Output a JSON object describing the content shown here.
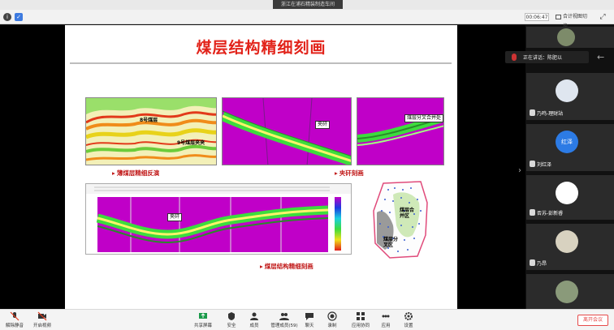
{
  "window": {
    "title": "浙江在浦石精装制造车间"
  },
  "topbar": {
    "time": "00:06:47",
    "view_label": "合计视图切换"
  },
  "slide": {
    "title": "煤层结构精细刻画",
    "captions": {
      "thin_seam": "薄煤层精细反演",
      "interbed": "夹矸刻画",
      "structure": "煤层结构精细刻画"
    },
    "labels": {
      "seam8": "8号煤层",
      "seam9": "9号煤层夹夹",
      "jiagan1": "夹矸",
      "split_merge": "煤层分叉合并处",
      "jiagan2": "夹矸",
      "merge_zone": "煤层合\n并区",
      "split_zone": "煤层分\n叉区"
    }
  },
  "participants": {
    "speaking_label": "正在讲话：陈肥以",
    "tiles": [
      {
        "name": ""
      },
      {
        "name": "乃鸣-理财站"
      },
      {
        "name": "刘红泽",
        "avatar_text": "红泽"
      },
      {
        "name": "否苏-彭新睿"
      },
      {
        "name": "乃昂"
      },
      {
        "name": ""
      }
    ]
  },
  "toolbar": {
    "mute": "解除静音",
    "video": "开启视频",
    "share": "共享屏幕",
    "security": "安全",
    "members": "成员",
    "manage": "管理成员(59)",
    "chat": "聊天",
    "record": "录制",
    "apps": "应用协同",
    "more": "应用",
    "settings": "设置",
    "end": "离开会议"
  },
  "colors": {
    "accent_red": "#e2231a",
    "seismic_purple": "#c000c8",
    "seam_green": "#3ddc3d",
    "end_red": "#e64a4a"
  }
}
